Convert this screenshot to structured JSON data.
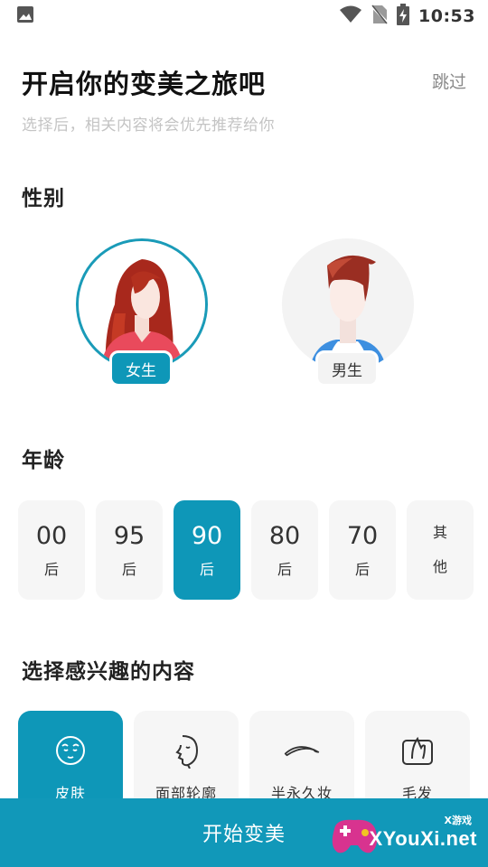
{
  "status_bar": {
    "time": "10:53"
  },
  "header": {
    "title": "开启你的变美之旅吧",
    "skip_label": "跳过",
    "subtitle": "选择后，相关内容将会优先推荐给你"
  },
  "gender": {
    "section_title": "性别",
    "options": [
      {
        "label": "女生",
        "selected": true
      },
      {
        "label": "男生",
        "selected": false
      }
    ]
  },
  "age": {
    "section_title": "年龄",
    "options": [
      {
        "top": "00",
        "bottom": "后",
        "selected": false
      },
      {
        "top": "95",
        "bottom": "后",
        "selected": false
      },
      {
        "top": "90",
        "bottom": "后",
        "selected": true
      },
      {
        "top": "80",
        "bottom": "后",
        "selected": false
      },
      {
        "top": "70",
        "bottom": "后",
        "selected": false
      },
      {
        "top": "其",
        "bottom": "他",
        "selected": false
      }
    ]
  },
  "interests": {
    "section_title": "选择感兴趣的内容",
    "options": [
      {
        "label": "皮肤",
        "icon": "face-icon",
        "selected": true
      },
      {
        "label": "面部轮廓",
        "icon": "face-profile-icon",
        "selected": false
      },
      {
        "label": "半永久妆",
        "icon": "eyebrow-icon",
        "selected": false
      },
      {
        "label": "毛发",
        "icon": "hair-icon",
        "selected": false
      }
    ]
  },
  "cta": {
    "label": "开始变美"
  },
  "watermark": {
    "top": "X游戏",
    "text": "XYouXi.net"
  },
  "colors": {
    "accent": "#0e97b8",
    "card_bg": "#f6f6f6",
    "subtitle": "#c4c4c4"
  }
}
